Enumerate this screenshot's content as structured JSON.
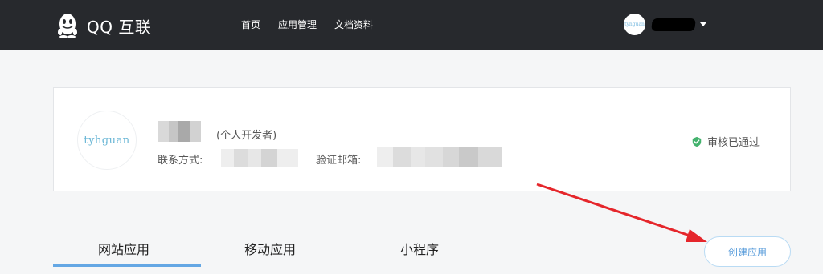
{
  "header": {
    "brand": "QQ 互联",
    "nav": [
      "首页",
      "应用管理",
      "文档资料"
    ],
    "user": {
      "avatar_text": "tyhguan",
      "menu_icon": "caret-down-icon"
    }
  },
  "profile": {
    "avatar_text": "tyhguan",
    "developer_type": "(个人开发者)",
    "contact_label": "联系方式:",
    "email_label": "验证邮箱:",
    "status": "审核已通过",
    "status_icon": "check-shield-icon"
  },
  "tabs": [
    "网站应用",
    "移动应用",
    "小程序"
  ],
  "actions": {
    "create_app": "创建应用"
  },
  "colors": {
    "header_bg": "#27292d",
    "accent": "#64a7e4",
    "status_green": "#43b26d",
    "annotation_red": "#e5262b"
  }
}
